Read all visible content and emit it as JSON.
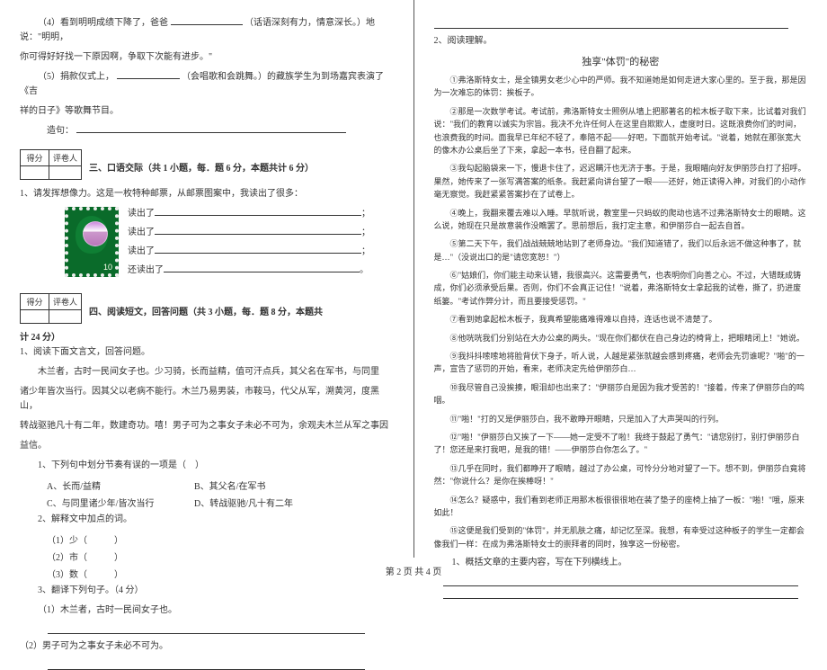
{
  "left": {
    "q4_pre": "（4）看到明明成绩下降了，爸爸",
    "q4_hint": "（话语深刻有力，情意深长。）地说：\"明明，",
    "q4_line2": "你可得好好找一下原因啊，争取下次能有进步。\"",
    "q5_pre": "（5）捐款仪式上，",
    "q5_hint": "（会唱歌和会跳舞。）的藏族学生为到场嘉宾表演了《吉",
    "q5_line2": "祥的日子》等歌舞节目。",
    "make_sentence": "造句：",
    "score_header1": "得分",
    "score_header2": "评卷人",
    "section3_title": "三、口语交际（共 1 小题，每．题 6 分，本题共计 6 分）",
    "stamp_intro": "1、请发挥想像力。这是一枚特种邮票，从邮票图案中，我读出了很多：",
    "readout": "读出了",
    "readalso": "还读出了",
    "stamp_value": "10",
    "section4_title": "四、阅读短文，回答问题（共 3 小题，每．题 8 分，本题共",
    "section4_title_cont": "计 24 分）",
    "reading1_title": "1、阅读下面文言文，回答问题。",
    "passage_p1": "木兰者，古时一民间女子也。少习骑，长而益精，值可汗点兵，其父名在军书，与同里",
    "passage_p2": "诸少年皆次当行。因其父以老病不能行。木兰乃易男装，市鞍马，代父从军，溯黄河，度黑山，",
    "passage_p3": "转战驱驰凡十有二年，数建奇功。嘻！男子可为之事女子未必不可为，余观夫木兰从军之事因",
    "passage_p4": "益信。",
    "q1_1": "1、下列句中划分节奏有误的一项是（　）",
    "q1_1_a": "A、长而/益精",
    "q1_1_b": "B、其父名/在军书",
    "q1_1_c": "C、与同里诸少年/皆次当行",
    "q1_1_d": "D、转战驱驰/凡十有二年",
    "q1_2": "2、解释文中加点的词。",
    "q1_2_1": "（1）少（　　　）",
    "q1_2_2": "（2）市（　　　）",
    "q1_2_3": "（3）数（　　　）",
    "q1_3": "3、翻译下列句子。（4 分）",
    "q1_3_1": "（1）木兰者，古时一民间女子也。",
    "q1_3_2": "（2）男子可为之事女子未必不可为。"
  },
  "right": {
    "title2": "2、阅读理解。",
    "story_title": "独享\"体罚\"的秘密",
    "p1": "①弗洛斯特女士，是全镇男女老少心中的严师。我不知道她是如何走进大家心里的。至于我，那是因为一次难忘的体罚：挨板子。",
    "p2": "②那是一次数学考试。考试前，弗洛斯特女士照例从墙上把那著名的松木板子取下来，比试着对我们说：\"我们的教育以诚实为宗旨。我决不允许任何人在这里自欺欺人，虚度时日。这既浪费你们的时间，也浪费我的时间。面我早已年纪不轻了，奉陪不起——好吧，下面就开始考试。\"说着，她就在那张宽大的像木办公桌后坐了下来，拿起一本书，径自翻了起来。",
    "p3": "③我勾起脑袋来一下，慢退卡住了，迟迟瞒汗也无济于事。于是，我眼瞄向好友伊丽莎白打了招呼。果然，她传来了一张写满答案的纸条。我赶紧向讲台望了一眼——还好，她正读得入神，对我们的小动作毫无察觉。我赶紧紧答案抄在了试卷上。",
    "p4": "④晚上，我翻来覆去难以入睡。早就听说，教室里一只蚂蚁的爬动也逃不过弗洛斯特女士的眼睛。这么说，她现在只是故意装作没瞧罢了。思前想后，我打定主意，和伊丽莎白一起去自首。",
    "p5": "⑤第二天下午，我们战战兢兢地站到了老师身边。\"我们知道错了，我们以后永远不做这种事了，就是…\"（没说出口的是\"请您宽恕！\"）",
    "p6": "⑥\"姑娘们，你们能主动来认错，我很高兴。这需要勇气，也表明你们向善之心。不过，大错既成铸成，你们必须承受后果。否则，你们不会真正记住！\"说着，弗洛斯特女士拿起我的试卷，撕了，扔进废纸篓。\"考试作弊分计，而且要接受惩罚。\"",
    "p7": "⑦看到她拿起松木板子，我真希望能痛难得难以自持，连话也说不清楚了。",
    "p8": "⑧他咣咣我们分别站在大办公桌的两头。\"现在你们都伏在自己身边的椅背上，把眼睛闭上！\"她说。",
    "p9": "⑨我抖抖嗦嗦地将脸背伏下身子，听人说，人越是紧张就越会感到疼痛，老师会先罚谁呢？\"啪\"的一声，宣告了惩罚的开始，看来，老师决定先给伊丽莎白…",
    "p10": "⑩我尽管自己没挨揍，眼泪却也出来了：\"伊丽莎白是因为我才受苦的！\"接着，传来了伊丽莎白的鸣咽。",
    "p11": "⑪\"啪！\"打的又是伊丽莎白，我不敢睁开眼睛，只是加入了大声哭叫的行列。",
    "p12": "⑫\"啪！\"伊丽莎白又挨了一下——她一定受不了啦！我终于鼓起了勇气：\"请您别打，别打伊丽莎白了！您还是来打我吧，是我的错！——伊丽莎白你怎么了。\"",
    "p13": "⑬几乎在同时，我们都睁开了眼睛，越过了办公桌，可怜分分地对望了一下。想不到，伊丽莎白竟将然：\"你说什么？是你在挨棒呀！\"",
    "p14": "⑭怎么？疑惑中，我们看到老师正用那木板很很很地在装了垫子的座椅上抽了一板：\"啪！\"哦，原来如此！",
    "p15": "⑮这便是我们受到的\"体罚\"，并无肌肤之痛，却记忆至深。我想，有幸受过这种板子的学生一定都会像我们一样：在成为弗洛斯特女士的崇拜者的同时，独享这一份秘密。",
    "q_summary": "1、概括文章的主要内容，写在下列横线上。"
  },
  "footer": "第 2 页  共 4 页"
}
